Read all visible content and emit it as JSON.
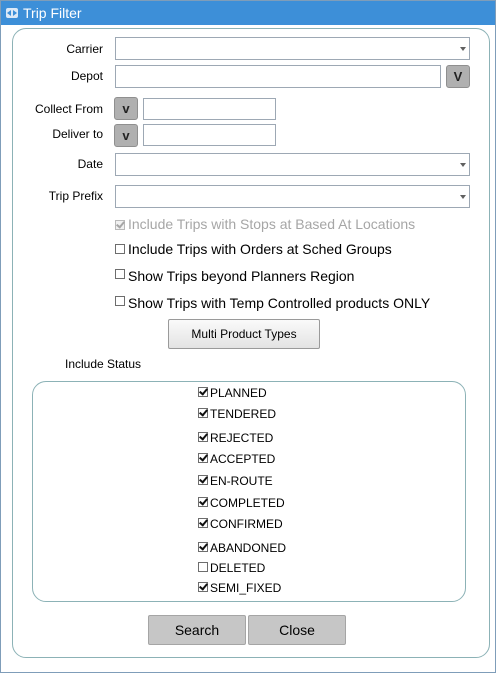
{
  "window": {
    "title": "Trip Filter"
  },
  "form": {
    "carrier_label": "Carrier",
    "carrier_value": "",
    "depot_label": "Depot",
    "depot_value": "",
    "collect_from_label": "Collect From",
    "collect_from_value": "",
    "deliver_to_label": "Deliver to",
    "deliver_to_value": "",
    "date_label": "Date",
    "date_value": "",
    "trip_prefix_label": "Trip Prefix",
    "trip_prefix_value": "",
    "lov_button_label": "V",
    "small_lov_label": "v"
  },
  "options": [
    {
      "label": "Include Trips with Stops at Based At Locations",
      "checked": true,
      "disabled": true
    },
    {
      "label": "Include Trips with Orders at Sched Groups",
      "checked": false,
      "disabled": false
    },
    {
      "label": "Show Trips beyond Planners Region",
      "checked": false,
      "disabled": false
    },
    {
      "label": "Show Trips with Temp Controlled products ONLY",
      "checked": false,
      "disabled": false
    }
  ],
  "multi_product_label": "Multi Product Types",
  "status_section_label": "Include Status",
  "statuses": [
    {
      "label": "PLANNED",
      "checked": true
    },
    {
      "label": "TENDERED",
      "checked": true
    },
    {
      "label": "REJECTED",
      "checked": true
    },
    {
      "label": "ACCEPTED",
      "checked": true
    },
    {
      "label": "EN-ROUTE",
      "checked": true
    },
    {
      "label": "COMPLETED",
      "checked": true
    },
    {
      "label": "CONFIRMED",
      "checked": true
    },
    {
      "label": "ABANDONED",
      "checked": true
    },
    {
      "label": "DELETED",
      "checked": false
    },
    {
      "label": "SEMI_FIXED",
      "checked": true
    }
  ],
  "buttons": {
    "search_label": "Search",
    "close_label": "Close"
  }
}
